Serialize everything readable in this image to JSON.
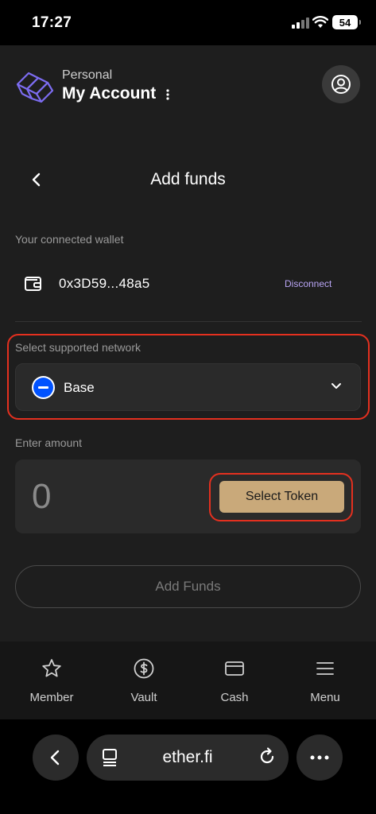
{
  "status_bar": {
    "time": "17:27",
    "battery": "54"
  },
  "header": {
    "account_type": "Personal",
    "account_name": "My Account",
    "logo_icon": "ether-fi-logo",
    "more_icon": "vertical-dots-icon",
    "profile_icon": "user-circle-icon"
  },
  "page": {
    "title": "Add funds",
    "back_icon": "chevron-left-icon"
  },
  "wallet": {
    "label": "Your connected wallet",
    "address": "0x3D59...48a5",
    "disconnect_label": "Disconnect",
    "icon": "wallet-icon"
  },
  "network": {
    "label": "Select supported network",
    "selected": "Base",
    "icon": "base-network-icon",
    "dropdown_icon": "chevron-down-icon"
  },
  "amount": {
    "label": "Enter amount",
    "value": "0",
    "select_token_label": "Select Token"
  },
  "submit": {
    "label": "Add Funds"
  },
  "bottom_nav": [
    {
      "label": "Member",
      "icon": "star-icon"
    },
    {
      "label": "Vault",
      "icon": "dollar-circle-icon"
    },
    {
      "label": "Cash",
      "icon": "card-icon"
    },
    {
      "label": "Menu",
      "icon": "hamburger-menu-icon"
    }
  ],
  "browser": {
    "url": "ether.fi"
  },
  "colors": {
    "accent_gold": "#c9a97a",
    "highlight_red": "#e4301f",
    "disconnect_purple": "#b9a5f5",
    "base_blue": "#0052ff"
  }
}
